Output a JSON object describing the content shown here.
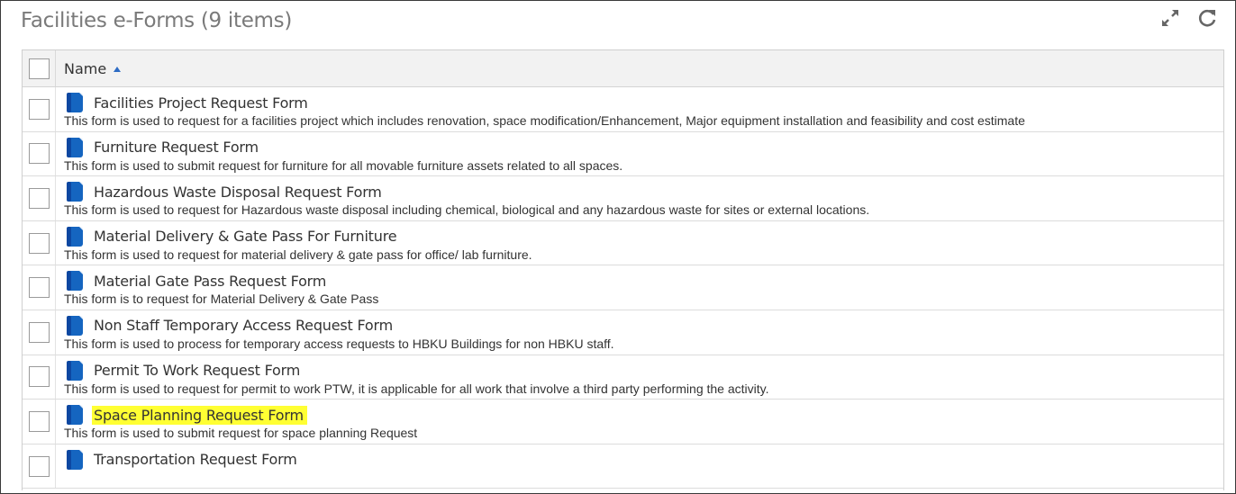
{
  "header": {
    "title": "Facilities e-Forms (9 items)",
    "toolbar": {
      "expand_icon": "expand-arrows-icon",
      "refresh_icon": "refresh-icon"
    }
  },
  "grid": {
    "column_name_label": "Name",
    "sort": "ascending",
    "accent_color": "#1565c0",
    "highlight_color": "#ffff33",
    "items": [
      {
        "name": "Facilities Project Request Form",
        "description": "This form is used to request for a facilities project which includes renovation, space modification/Enhancement, Major equipment installation and feasibility and cost estimate"
      },
      {
        "name": "Furniture Request Form",
        "description": "This form is used to submit request for furniture for all movable furniture assets related to all spaces."
      },
      {
        "name": "Hazardous Waste Disposal Request Form",
        "description": "This form is used to request for Hazardous waste disposal including chemical, biological and any hazardous waste for sites or external locations."
      },
      {
        "name": "Material Delivery & Gate Pass For Furniture",
        "description": "This form is used to request for material delivery & gate pass for office/ lab furniture."
      },
      {
        "name": "Material Gate Pass Request Form",
        "description": "This form is to request for Material Delivery & Gate Pass"
      },
      {
        "name": "Non Staff Temporary Access Request Form",
        "description": "This form is used to process for temporary access requests to HBKU Buildings for non HBKU staff."
      },
      {
        "name": "Permit To Work Request Form",
        "description": "This form is used to request for permit to work PTW, it is applicable for all work that involve a third party performing the activity."
      },
      {
        "name": "Space Planning Request Form",
        "description": "This form is used to submit request for space planning Request",
        "highlighted": true
      },
      {
        "name": "Transportation Request Form",
        "description": ""
      }
    ]
  }
}
